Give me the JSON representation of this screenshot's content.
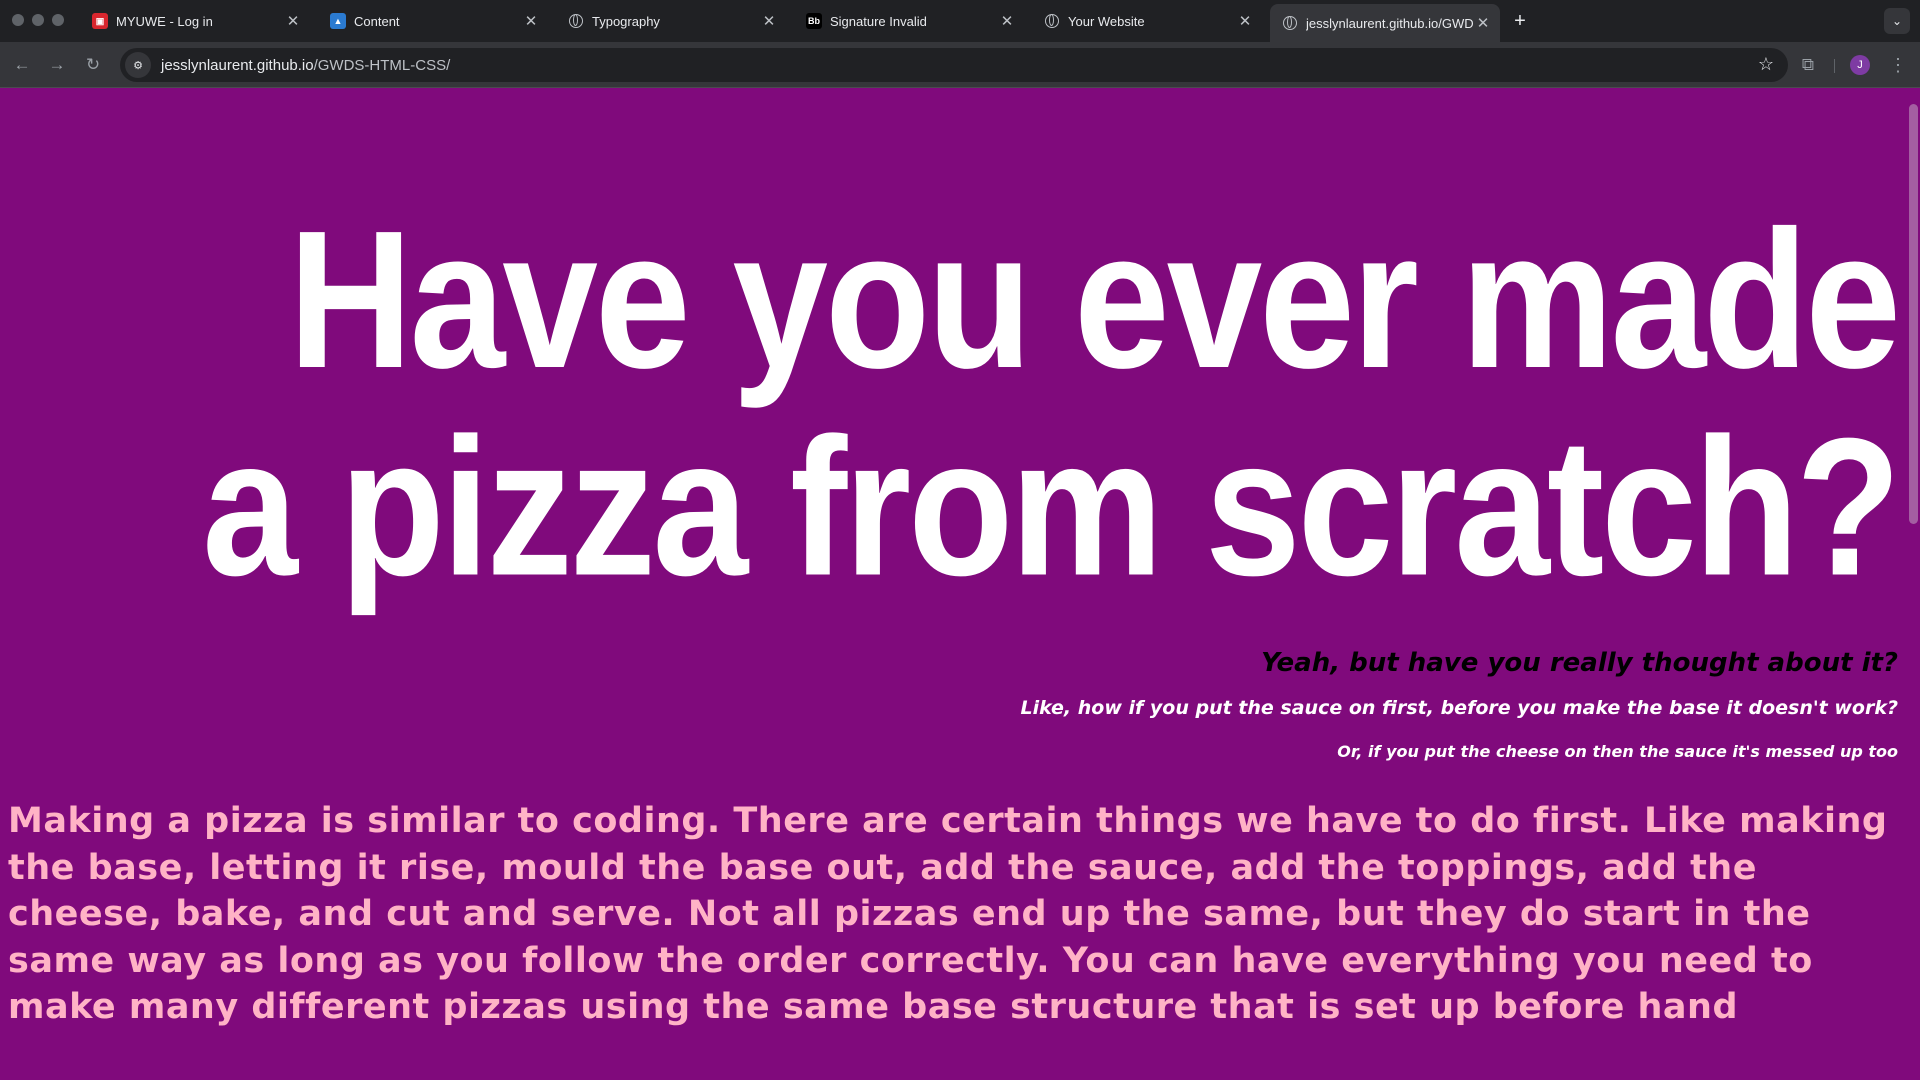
{
  "tabs": [
    {
      "title": "MYUWE - Log in",
      "favicon": "uwe-icon",
      "active": false
    },
    {
      "title": "Content",
      "favicon": "lms-icon",
      "active": false
    },
    {
      "title": "Typography",
      "favicon": "globe-icon",
      "active": false
    },
    {
      "title": "Signature Invalid",
      "favicon": "bb-icon",
      "favicon_text": "Bb",
      "active": false
    },
    {
      "title": "Your Website",
      "favicon": "globe-icon",
      "active": false
    },
    {
      "title": "jesslynlaurent.github.io/GWD",
      "favicon": "globe-icon",
      "active": true
    }
  ],
  "toolbar": {
    "url_host": "jesslynlaurent.github.io",
    "url_path": "/GWDS-HTML-CSS/",
    "avatar_letter": "J"
  },
  "page": {
    "background": "#800a7c",
    "headline": "Have you ever made a pizza from scratch?",
    "subheading_1": "Yeah, but have you really thought about it?",
    "subheading_2": "Like, how if you put the sauce on first, before you make the base it doesn't work?",
    "subheading_3": "Or, if you put the cheese on then the sauce it's messed up too",
    "paragraph": "Making a pizza is similar to coding. There are certain things we have to do first. Like making the base, letting it rise, mould the base out, add the sauce, add the toppings, add the cheese, bake, and cut and serve. Not all pizzas end up the same, but they do start in the same way as long as you follow the order correctly. You can have everything you need to make many different pizzas using the same base structure that is set up before hand",
    "paragraph_color": "#ffb3c6"
  }
}
